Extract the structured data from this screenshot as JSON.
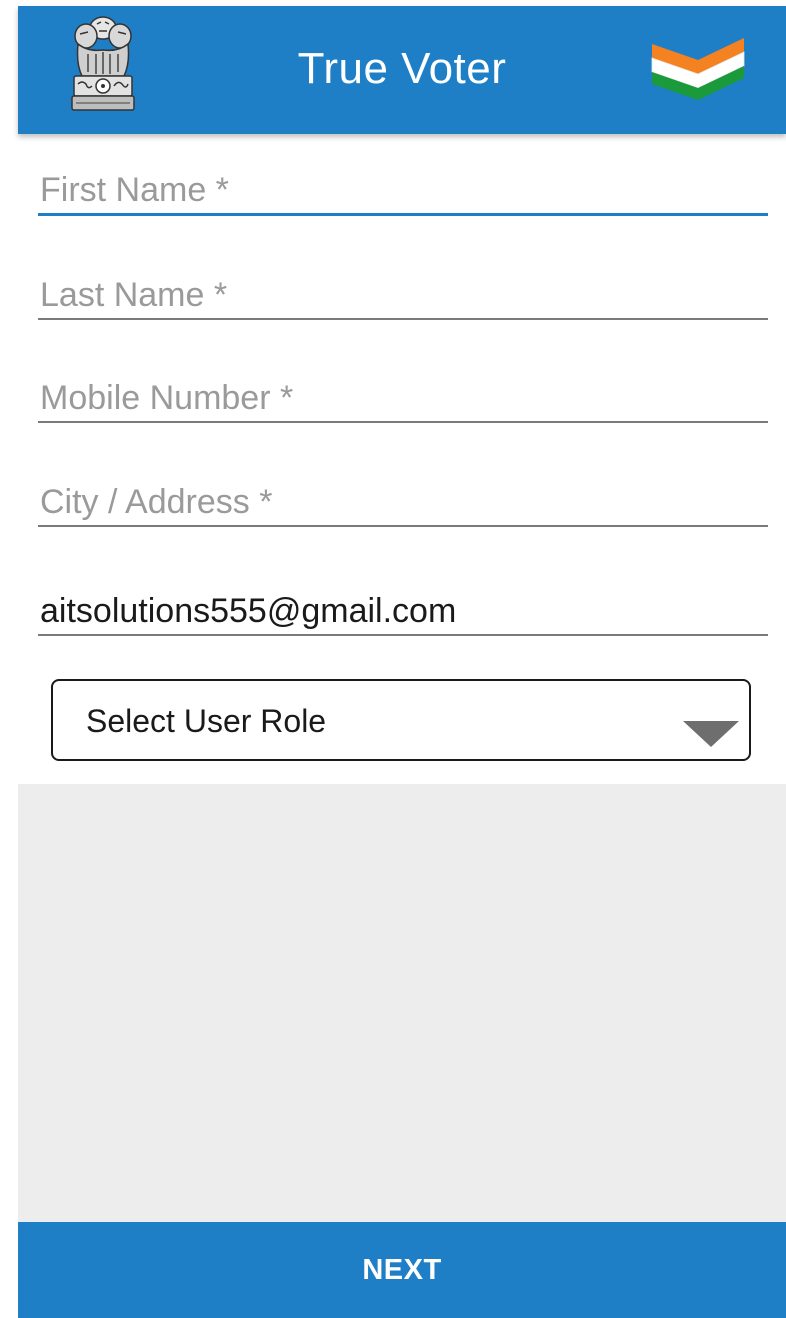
{
  "header": {
    "title": "True Voter",
    "left_icon": "national-emblem-icon",
    "right_icon": "tricolor-flag-icon",
    "bar_color": "#1f7fc6",
    "flag_colors": [
      "#f58220",
      "#ffffff",
      "#1a9a3a"
    ]
  },
  "form": {
    "first_name": {
      "placeholder": "First Name *",
      "value": ""
    },
    "last_name": {
      "placeholder": "Last Name *",
      "value": ""
    },
    "mobile": {
      "placeholder": "Mobile Number *",
      "value": ""
    },
    "city": {
      "placeholder": "City / Address *",
      "value": ""
    },
    "email": {
      "placeholder": "",
      "value": "aitsolutions555@gmail.com"
    },
    "role_select": {
      "selected": "Select User Role",
      "icon": "dropdown-arrow-icon"
    }
  },
  "footer": {
    "next_label": "NEXT"
  }
}
